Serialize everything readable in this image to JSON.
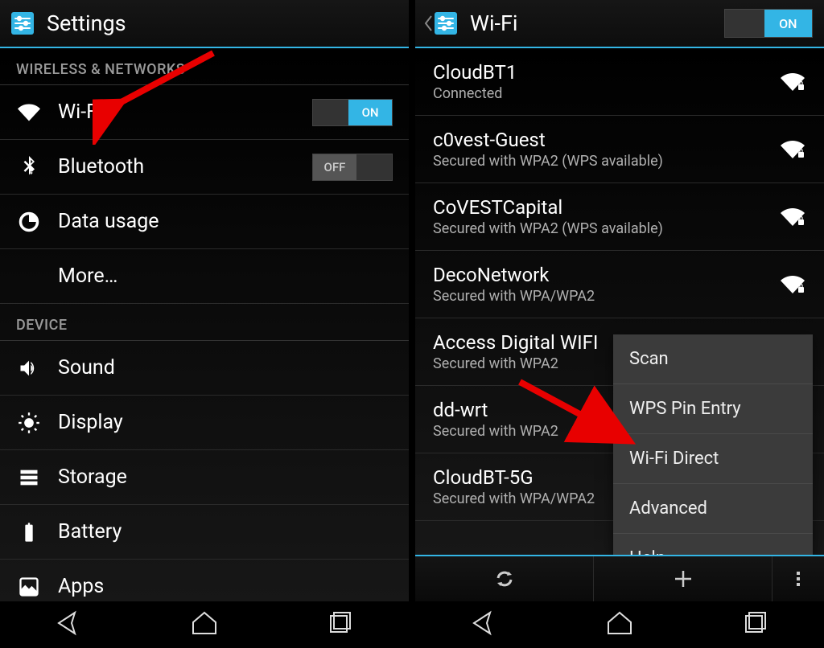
{
  "left": {
    "title": "Settings",
    "sections": {
      "wireless_header": "WIRELESS & NETWORKS",
      "device_header": "DEVICE"
    },
    "rows": {
      "wifi_label": "Wi-Fi",
      "wifi_toggle": "ON",
      "bluetooth_label": "Bluetooth",
      "bluetooth_toggle": "OFF",
      "data_usage_label": "Data usage",
      "more_label": "More…",
      "sound_label": "Sound",
      "display_label": "Display",
      "storage_label": "Storage",
      "battery_label": "Battery",
      "apps_label": "Apps"
    }
  },
  "right": {
    "title": "Wi-Fi",
    "toggle": "ON",
    "networks": [
      {
        "ssid": "CloudBT1",
        "status": "Connected",
        "secured": true
      },
      {
        "ssid": "c0vest-Guest",
        "status": "Secured with WPA2 (WPS available)",
        "secured": true
      },
      {
        "ssid": "CoVESTCapital",
        "status": "Secured with WPA2 (WPS available)",
        "secured": true
      },
      {
        "ssid": "DecoNetwork",
        "status": "Secured with WPA/WPA2",
        "secured": true
      },
      {
        "ssid": "Access Digital WIFI",
        "status": "Secured with WPA2",
        "secured": true
      },
      {
        "ssid": "dd-wrt",
        "status": "Secured with WPA2",
        "secured": true
      },
      {
        "ssid": "CloudBT-5G",
        "status": "Secured with WPA/WPA2",
        "secured": true
      }
    ],
    "popup": {
      "items": {
        "scan": "Scan",
        "wps": "WPS Pin Entry",
        "direct": "Wi-Fi Direct",
        "advanced": "Advanced",
        "help": "Help"
      }
    }
  }
}
